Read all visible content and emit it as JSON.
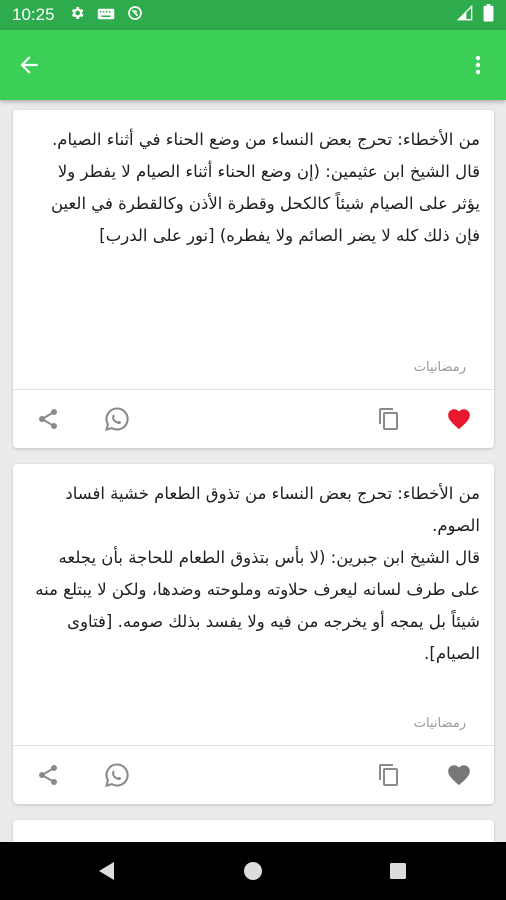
{
  "status_bar": {
    "time": "10:25",
    "icons": [
      "gear-icon",
      "keyboard-icon",
      "no-sync-icon",
      "signal-icon",
      "battery-icon"
    ]
  },
  "toolbar": {
    "icons": [
      "back-arrow-icon",
      "more-vert-icon"
    ]
  },
  "posts": [
    {
      "paragraphs": [
        "من الأخطاء: تحرج بعض النساء من وضع الحناء في أثناء الصيام.",
        "قال الشيخ ابن عثيمين: (إن وضع الحناء أثناء الصيام لا يفطر ولا يؤثر على الصيام شيئاً كالكحل وقطرة الأذن وكالقطرة في العين فإن ذلك كله لا يضر الصائم ولا يفطره) [نور على الدرب]"
      ],
      "tag": "رمضانيات",
      "favorited": true
    },
    {
      "paragraphs": [
        "من الأخطاء: تحرج بعض النساء من تذوق الطعام خشية افساد الصوم.",
        "قال الشيخ ابن جبرين: (لا بأس بتذوق الطعام للحاجة بأن يجلعه على طرف لسانه ليعرف حلاوته وملوحته وضدها، ولكن لا يبتلع منه شيئاً بل يمجه أو يخرجه من فيه ولا يفسد بذلك صومه. [فتاوى الصيام]."
      ],
      "tag": "رمضانيات",
      "favorited": false
    }
  ],
  "colors": {
    "status_bar": "#2eab4c",
    "app_bar": "#3ccf58",
    "favorite_active": "#e8192c",
    "favorite_inactive": "#777777",
    "icon_gray": "#8a8a8a"
  }
}
